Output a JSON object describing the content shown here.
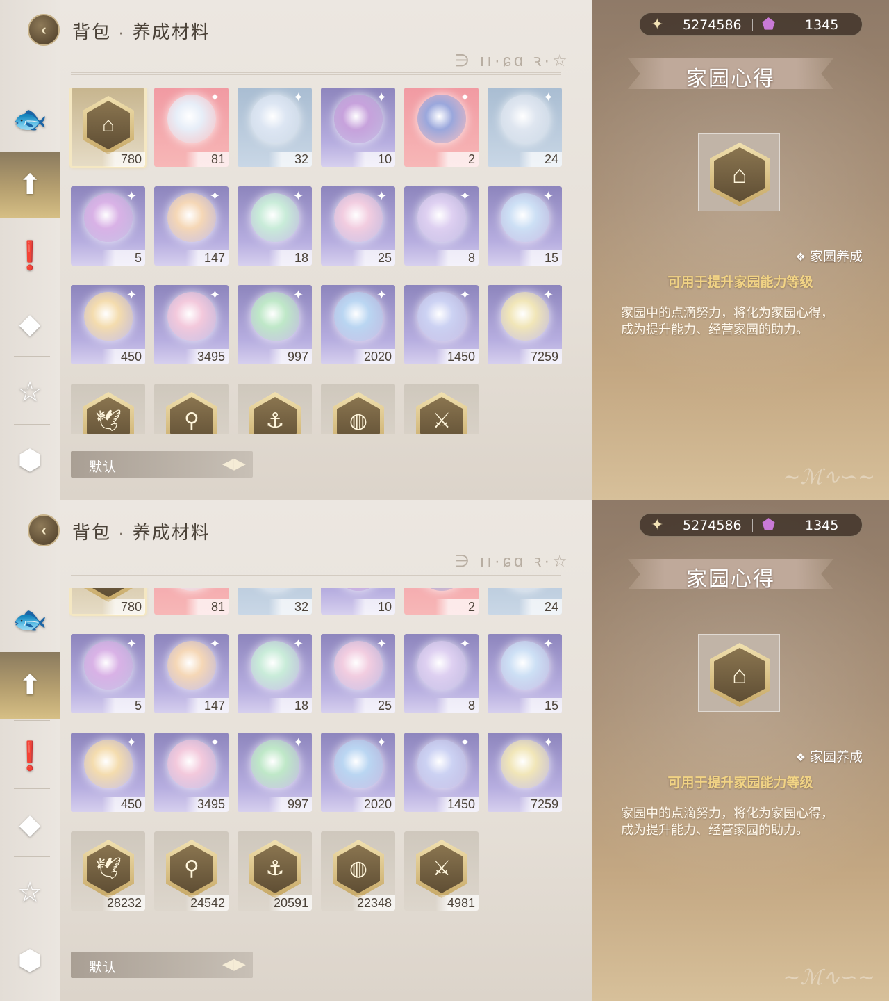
{
  "header": {
    "title_part1": "背包",
    "separator": "·",
    "title_part2": "养成材料",
    "deco_text": "∋ ıı·ɕɑ ꝛ·☆"
  },
  "sidenav": [
    {
      "name": "fish",
      "glyph": "🐟"
    },
    {
      "name": "upgrade",
      "glyph": "⬆",
      "active": true
    },
    {
      "name": "alert",
      "glyph": "❗"
    },
    {
      "name": "crystal",
      "glyph": "◆"
    },
    {
      "name": "star-wand",
      "glyph": "☆"
    },
    {
      "name": "cube",
      "glyph": "⬢"
    }
  ],
  "currency": {
    "gold_value": "5274586",
    "gem_value": "1345",
    "gold_icon": "✦",
    "gem_icon": "⬟"
  },
  "items": [
    {
      "icon": "house",
      "glyph": "⌂",
      "count": "780",
      "bg": "gold",
      "kind": "hex",
      "selected": true
    },
    {
      "icon": "paint-bucket",
      "count": "81",
      "bg": "pink",
      "kind": "orb",
      "color": "#e7eef8"
    },
    {
      "icon": "crystal-orb",
      "count": "32",
      "bg": "blue",
      "kind": "orb",
      "color": "#dde6f3"
    },
    {
      "icon": "purple-crystal",
      "count": "10",
      "bg": "purple",
      "kind": "orb",
      "color": "#c7a2dc"
    },
    {
      "icon": "galaxy-cards",
      "count": "2",
      "bg": "pink",
      "kind": "orb",
      "color": "#9aa7dc"
    },
    {
      "icon": "silver-crystal",
      "count": "24",
      "bg": "blue",
      "kind": "orb",
      "color": "#dfe6f0"
    },
    {
      "icon": "rose-crystal",
      "count": "5",
      "bg": "purple",
      "kind": "orb",
      "color": "#d9b2e6"
    },
    {
      "icon": "orange-bubble",
      "count": "147",
      "bg": "purple",
      "kind": "orb",
      "color": "#f5d7b6"
    },
    {
      "icon": "green-bubble",
      "count": "18",
      "bg": "purple",
      "kind": "orb",
      "color": "#c9ecd9"
    },
    {
      "icon": "pink-bubble",
      "count": "25",
      "bg": "purple",
      "kind": "orb",
      "color": "#f2cde0"
    },
    {
      "icon": "lilac-bubble",
      "count": "8",
      "bg": "purple",
      "kind": "orb",
      "color": "#ded0f1"
    },
    {
      "icon": "blue-bubble",
      "count": "15",
      "bg": "purple",
      "kind": "orb",
      "color": "#cde0f5"
    },
    {
      "icon": "gold-shell",
      "count": "450",
      "bg": "purple",
      "kind": "shell",
      "color": "#f4dcae"
    },
    {
      "icon": "pink-shell",
      "count": "3495",
      "bg": "purple",
      "kind": "shell",
      "color": "#f3c9dc"
    },
    {
      "icon": "green-shell",
      "count": "997",
      "bg": "purple",
      "kind": "shell",
      "color": "#bfe8c8"
    },
    {
      "icon": "blue-shell",
      "count": "2020",
      "bg": "purple",
      "kind": "shell",
      "color": "#bad6f2"
    },
    {
      "icon": "violet-shell",
      "count": "1450",
      "bg": "purple",
      "kind": "shell",
      "color": "#ccd2f3"
    },
    {
      "icon": "gold-pearl",
      "count": "7259",
      "bg": "purple",
      "kind": "orb",
      "color": "#f1e6b8"
    },
    {
      "icon": "bird-hand",
      "glyph": "🕊",
      "count": "28232",
      "bg": "beige",
      "kind": "hex"
    },
    {
      "icon": "bug-net",
      "glyph": "⚲",
      "count": "24542",
      "bg": "beige",
      "kind": "hex"
    },
    {
      "icon": "fishing-rod",
      "glyph": "⚓",
      "count": "20591",
      "bg": "beige",
      "kind": "hex"
    },
    {
      "icon": "basket",
      "glyph": "◍",
      "count": "22348",
      "bg": "beige",
      "kind": "hex"
    },
    {
      "icon": "crossed-tools",
      "glyph": "⚔",
      "count": "4981",
      "bg": "beige",
      "kind": "hex"
    }
  ],
  "sort": {
    "label": "默认",
    "icon": "◀▶"
  },
  "detail": {
    "name": "家园心得",
    "icon_glyph": "⌂",
    "tag_diamond": "❖",
    "tag": "家园养成",
    "usage": "可用于提升家园能力等级",
    "description": "家园中的点滴努力，将化为家园心得，成为提升能力、经营家园的助力。"
  }
}
